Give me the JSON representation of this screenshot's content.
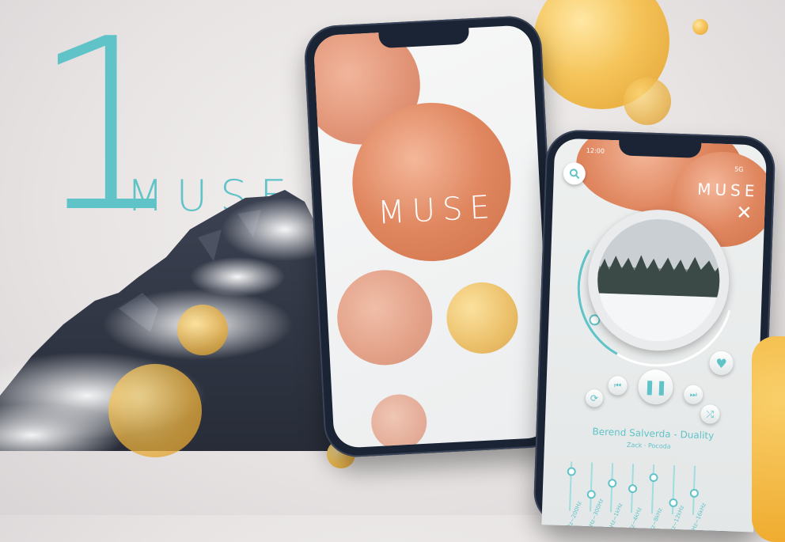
{
  "hero": {
    "number": "1",
    "brand": "MUSE"
  },
  "splash": {
    "brand": "MUSE"
  },
  "player": {
    "status_time": "12:00",
    "status_signal": "5G",
    "brand": "MUSE",
    "close_label": "✕",
    "search_icon": "search-icon",
    "song_title": "Berend Salverda - Duality",
    "artist": "Zack · Pocoda",
    "favorite_icon": "heart-icon",
    "controls": [
      "repeat-icon",
      "previous-icon",
      "pause-icon",
      "next-icon",
      "shuffle-icon"
    ],
    "equalizer": [
      {
        "label": "60Hz~200Hz",
        "level": 0.8
      },
      {
        "label": "150Hz~300Hz",
        "level": 0.35
      },
      {
        "label": "300Hz~1kHz",
        "level": 0.6
      },
      {
        "label": "1kHz~4kHz",
        "level": 0.5
      },
      {
        "label": "4kHz~8kHz",
        "level": 0.75
      },
      {
        "label": "8kHz~12kHz",
        "level": 0.25
      },
      {
        "label": "12kHz~16kHz",
        "level": 0.45
      }
    ]
  },
  "colors": {
    "accent": "#5fc3c8",
    "gold": "#f3be4f",
    "orange": "#e08760",
    "phone": "#1b2434"
  }
}
